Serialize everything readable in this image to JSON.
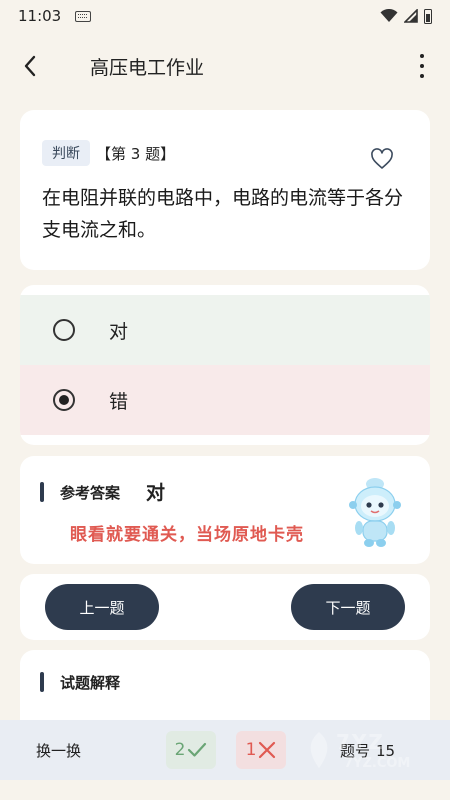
{
  "status_bar": {
    "time": "11:03"
  },
  "header": {
    "title": "高压电工作业"
  },
  "question": {
    "type_tag": "判断",
    "number_label": "【第 3 题】",
    "text": "在电阻并联的电路中，电路的电流等于各分支电流之和。"
  },
  "options": [
    {
      "label": "对",
      "checked": false
    },
    {
      "label": "错",
      "checked": true
    }
  ],
  "answer": {
    "label": "参考答案",
    "value": "对",
    "encourage": "眼看就要通关，当场原地卡壳"
  },
  "nav": {
    "prev_label": "上一题",
    "next_label": "下一题"
  },
  "explain": {
    "label": "试题解释"
  },
  "bottom": {
    "switch_label": "换一换",
    "correct_count": "2",
    "wrong_count": "1",
    "qno_label": "题号",
    "qno_value": "15"
  },
  "watermark": {
    "brand": "7YZ.COM"
  },
  "colors": {
    "accent_dark": "#2e3b4e",
    "correct_bg": "#eef3ee",
    "wrong_bg": "#f8eaea",
    "warning_text": "#e05a52",
    "background": "#f7f3ec"
  }
}
